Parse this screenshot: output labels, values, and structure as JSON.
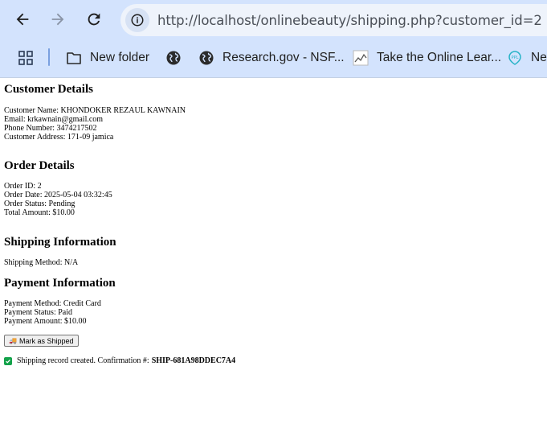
{
  "browser": {
    "url": "http://localhost/onlinebeauty/shipping.php?customer_id=2",
    "bookmarks": [
      {
        "label": "New folder",
        "icon": "folder-icon"
      },
      {
        "label": "",
        "icon": "globe-icon"
      },
      {
        "label": "Research.gov - NSF...",
        "icon": "globe-icon"
      },
      {
        "label": "Take the Online Lear...",
        "icon": "chart-favicon-icon"
      },
      {
        "label": "Nex",
        "icon": "ppl-favicon-icon"
      }
    ]
  },
  "customer": {
    "heading": "Customer Details",
    "name": "Customer Name: KHONDOKER REZAUL KAWNAIN",
    "email": "Email: krkawnain@gmail.com",
    "phone": "Phone Number: 3474217502",
    "address": "Customer Address: 171-09 jamica"
  },
  "order": {
    "heading": "Order Details",
    "id": "Order ID: 2",
    "date": "Order Date: 2025-05-04 03:32:45",
    "status": "Order Status: Pending",
    "total": "Total Amount: $10.00"
  },
  "shipping": {
    "heading": "Shipping Information",
    "method": "Shipping Method: N/A"
  },
  "payment": {
    "heading": "Payment Information",
    "method": "Payment Method: Credit Card",
    "status": "Payment Status: Paid",
    "amount": "Payment Amount: $10.00"
  },
  "actions": {
    "mark_shipped_label": "Mark as Shipped",
    "truck_glyph": "🚚"
  },
  "confirmation": {
    "text": "Shipping record created. Confirmation #:",
    "code": "SHIP-681A98DDEC7A4"
  },
  "colors": {
    "chrome_bg": "#d3e3fd",
    "check_green": "#13a24a"
  }
}
